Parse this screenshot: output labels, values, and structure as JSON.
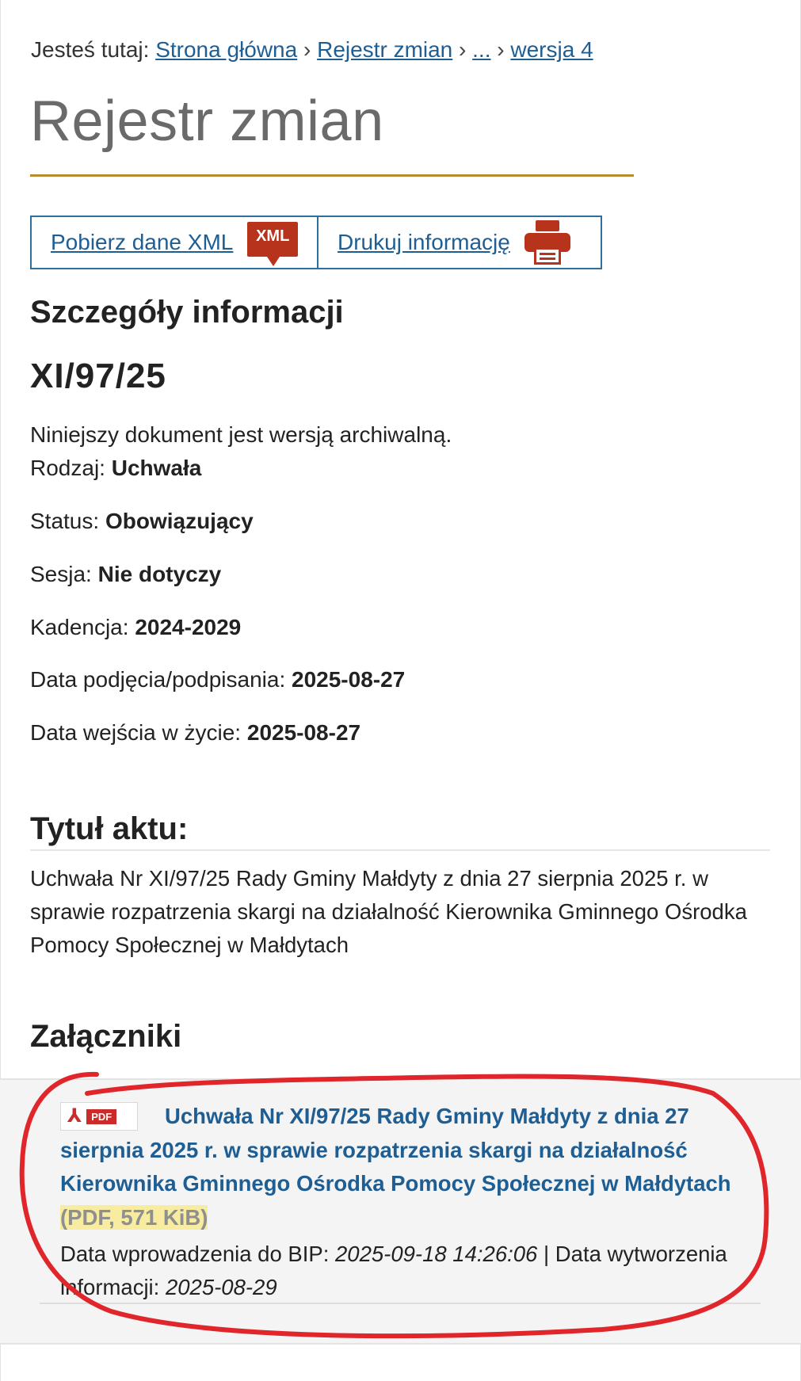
{
  "breadcrumb": {
    "prefix": "Jesteś tutaj:",
    "items": [
      {
        "label": "Strona główna"
      },
      {
        "label": "Rejestr zmian"
      },
      {
        "label": "..."
      },
      {
        "label": "wersja 4"
      }
    ],
    "separator": "›"
  },
  "page_title": "Rejestr zmian",
  "actions": {
    "xml_label": "Pobierz dane XML",
    "xml_icon_text": "XML",
    "print_label": "Drukuj informację"
  },
  "details": {
    "heading": "Szczegóły informacji",
    "number": "XI/97/25",
    "archive_note": "Niniejszy dokument jest wersją archiwalną.",
    "fields": [
      {
        "label": "Rodzaj:",
        "value": "Uchwała"
      },
      {
        "label": "Status:",
        "value": "Obowiązujący"
      },
      {
        "label": "Sesja:",
        "value": "Nie dotyczy"
      },
      {
        "label": "Kadencja:",
        "value": "2024-2029"
      },
      {
        "label": "Data podjęcia/podpisania:",
        "value": "2025-08-27"
      },
      {
        "label": "Data wejścia w życie:",
        "value": "2025-08-27"
      }
    ]
  },
  "act": {
    "heading": "Tytuł aktu:",
    "text": "Uchwała Nr XI/97/25 Rady Gminy Małdyty z dnia 27 sierpnia 2025 r. w sprawie rozpatrzenia skargi na działalność Kierownika Gminnego Ośrodka Pomocy Społecznej w Małdytach"
  },
  "attachments": {
    "heading": "Załączniki",
    "items": [
      {
        "icon_tag": "PDF",
        "title": "Uchwała Nr XI/97/25 Rady Gminy Małdyty z dnia 27 sierpnia 2025 r. w sprawie rozpatrzenia skargi na działalność Kierownika Gminnego Ośrodka Pomocy Społecznej w Małdytach",
        "meta": "(PDF, 571 KiB)",
        "entry_label": "Data wprowadzenia do BIP:",
        "entry_value": "2025-09-18 14:26:06",
        "divider": "|",
        "created_label": "Data wytworzenia informacji:",
        "created_value": "2025-08-29"
      }
    ]
  },
  "colors": {
    "link": "#1f5e93",
    "title_rule": "#b98b2e",
    "icon_red": "#b8331c",
    "annotation_red": "#e0262b",
    "highlight": "#f7eca0"
  }
}
